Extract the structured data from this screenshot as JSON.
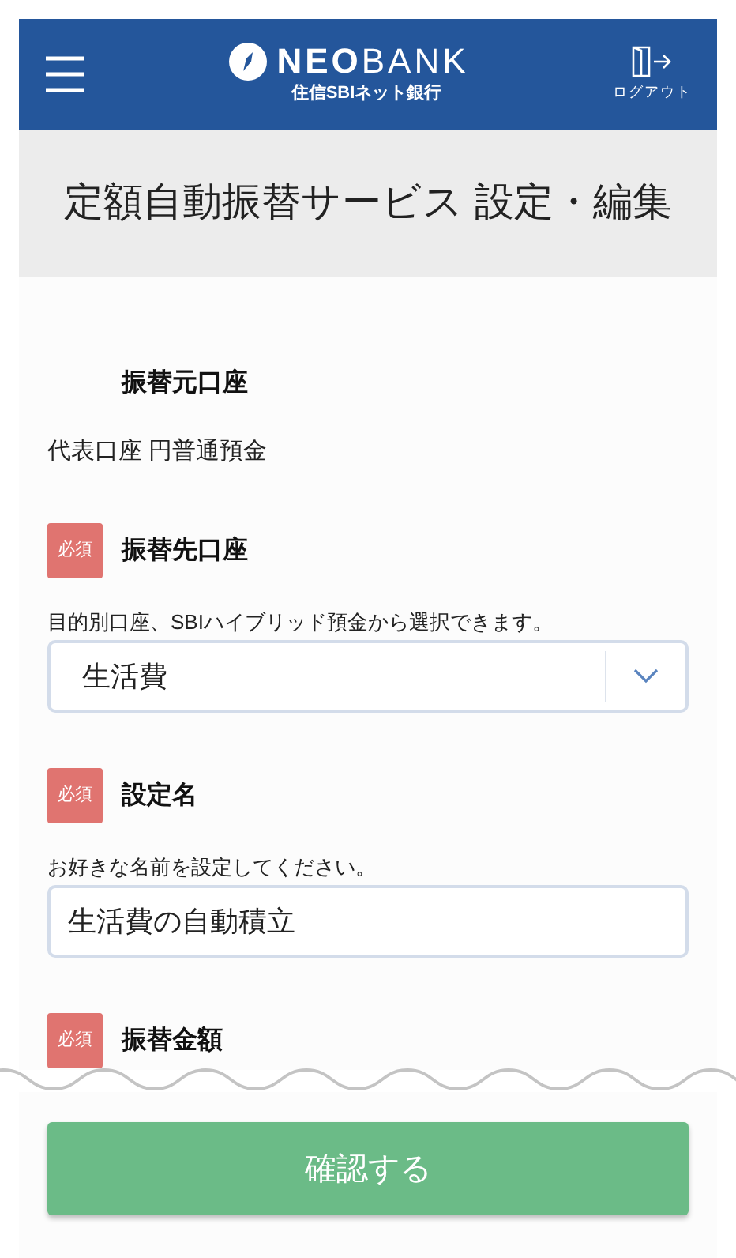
{
  "header": {
    "logo": {
      "bold": "NEO",
      "light": "BANK",
      "subtitle": "住信SBIネット銀行"
    },
    "logout": "ログアウト"
  },
  "page_title": "定額自動振替サービス 設定・編集",
  "fields": [
    {
      "kind": "static",
      "label": "振替元口座",
      "required": false,
      "value": "代表口座 円普通預金"
    },
    {
      "kind": "select",
      "label": "振替先口座",
      "required": true,
      "badge": "必須",
      "hint": "目的別口座、SBIハイブリッド預金から選択できます。",
      "value": "生活費"
    },
    {
      "kind": "input",
      "label": "設定名",
      "required": true,
      "badge": "必須",
      "hint": "お好きな名前を設定してください。",
      "value": "生活費の自動積立"
    },
    {
      "kind": "label",
      "label": "振替金額",
      "required": true,
      "badge": "必須"
    }
  ],
  "confirm_button": "確認する"
}
